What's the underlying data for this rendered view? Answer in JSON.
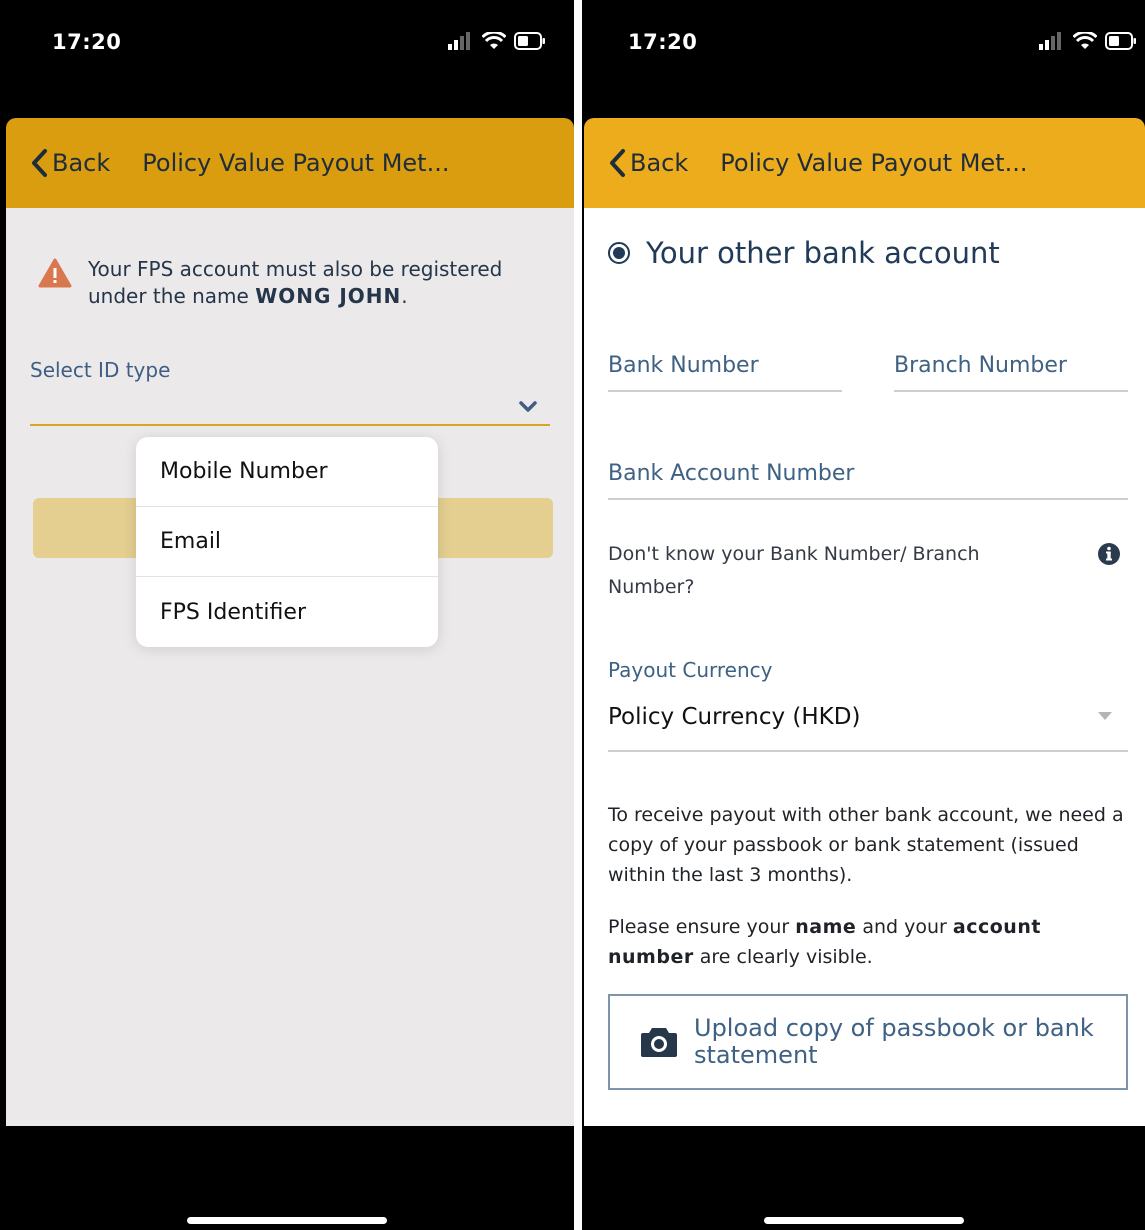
{
  "left": {
    "status": {
      "time": "17:20"
    },
    "header": {
      "back_label": "Back",
      "title": "Policy Value Payout Met..."
    },
    "warning": {
      "text": "Your FPS account must also be registered under the name ",
      "name": "WONG JOHN",
      "suffix": "."
    },
    "id_select": {
      "label": "Select ID type",
      "value": ""
    },
    "dropdown": {
      "options": [
        "Mobile Number",
        "Email",
        "FPS Identifier"
      ]
    }
  },
  "right": {
    "status": {
      "time": "17:20"
    },
    "header": {
      "back_label": "Back",
      "title": "Policy Value Payout Met..."
    },
    "option": {
      "label": "Your other bank account",
      "selected": true
    },
    "fields": {
      "bank_number": "Bank Number",
      "branch_number": "Branch Number",
      "account_number": "Bank Account Number"
    },
    "help": {
      "text": "Don't know your Bank Number/ Branch Number?"
    },
    "currency": {
      "label": "Payout Currency",
      "value": "Policy Currency (HKD)"
    },
    "instructions": {
      "para1": "To receive payout with other bank account, we need a copy of your passbook or bank statement (issued within the last 3 months).",
      "para2_a": "Please ensure your ",
      "para2_name": "name",
      "para2_b": " and your ",
      "para2_account": "account number",
      "para2_c": " are clearly visible."
    },
    "upload": {
      "label": "Upload copy of passbook or bank statement"
    }
  },
  "colors": {
    "header_left": "#d99d0f",
    "header_right": "#edac1b",
    "primary_text": "#1f3b57",
    "link_blue": "#3e6184",
    "warning_icon": "#d9774f"
  }
}
